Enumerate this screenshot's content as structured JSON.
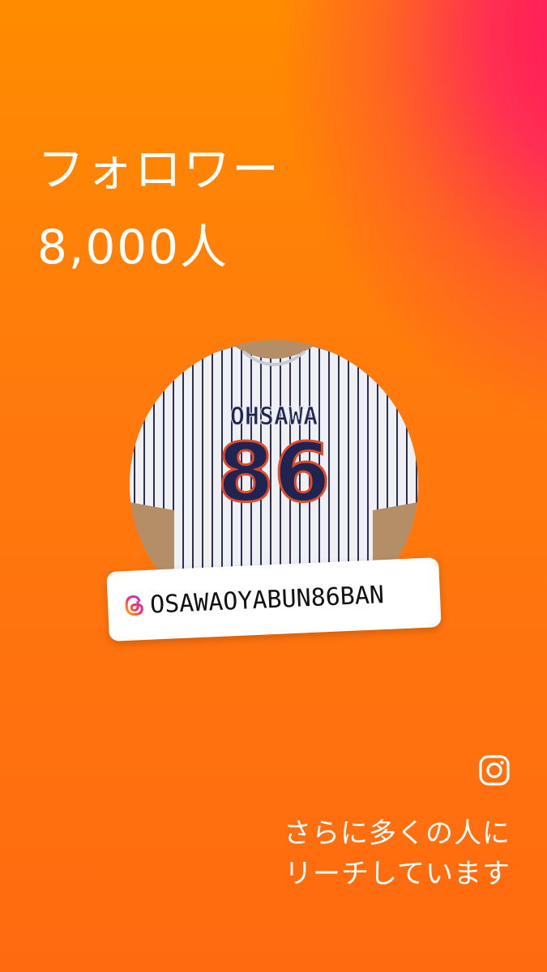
{
  "headline": {
    "title": "フォロワー",
    "count": "8,000人"
  },
  "profile": {
    "image": "baseball-jersey-photo",
    "jersey_name": "OHSAWA",
    "jersey_number": "86",
    "username": "OSAWAOYABUN86BAN",
    "tag_icon": "threads-icon"
  },
  "footer": {
    "icon": "instagram-icon",
    "reach_line1": "さらに多くの人に",
    "reach_line2": "リーチしています"
  },
  "colors": {
    "orange": "#ff8c00",
    "pink": "#ff0f5e"
  }
}
